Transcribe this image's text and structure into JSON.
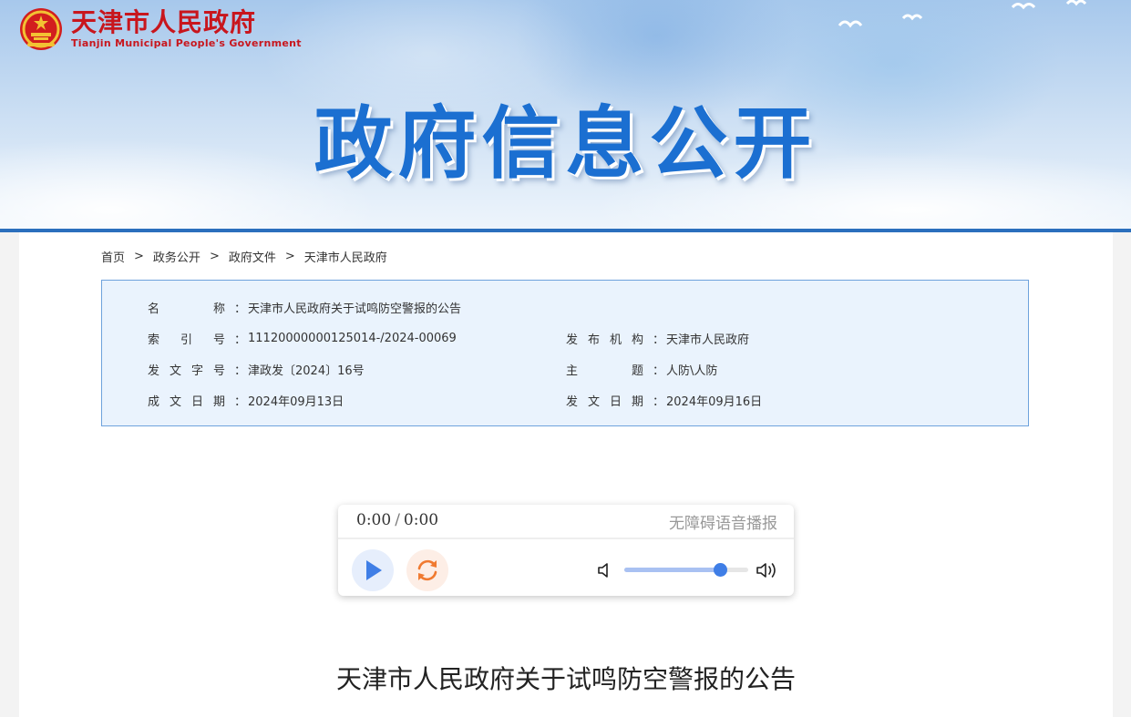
{
  "header": {
    "site_name_cn": "天津市人民政府",
    "site_name_en": "Tianjin Municipal People's Government",
    "banner_title": "政府信息公开"
  },
  "breadcrumb": {
    "items": [
      "首页",
      "政务公开",
      "政府文件",
      "天津市人民政府"
    ],
    "separator": ">"
  },
  "metadata": {
    "name_label": "名称",
    "name_value": "天津市人民政府关于试鸣防空警报的公告",
    "index_label": "索引号",
    "index_value": "11120000000125014-/2024-00069",
    "publisher_label": "发布机构",
    "publisher_value": "天津市人民政府",
    "doc_no_label": "发文字号",
    "doc_no_value": "津政发〔2024〕16号",
    "subject_label": "主题",
    "subject_value": "人防\\人防",
    "created_label": "成文日期",
    "created_value": "2024年09月13日",
    "issued_label": "发文日期",
    "issued_value": "2024年09月16日",
    "colon": "："
  },
  "player": {
    "current_time": "0:00",
    "duration": "0:00",
    "slash": "/",
    "label": "无障碍语音播报",
    "volume_fraction": 0.77,
    "colors": {
      "play_bg": "#e6eefc",
      "play_icon": "#3f7ee6",
      "replay_bg": "#fdeee6",
      "replay_icon": "#f07a30"
    }
  },
  "article": {
    "title": "天津市人民政府关于试鸣防空警报的公告"
  },
  "colors": {
    "brand_red": "#c8161d",
    "banner_blue": "#1b6fd1",
    "accent_line": "#2b6fbd",
    "meta_bg": "#eaf3fd",
    "meta_border": "#6ea2dc"
  }
}
